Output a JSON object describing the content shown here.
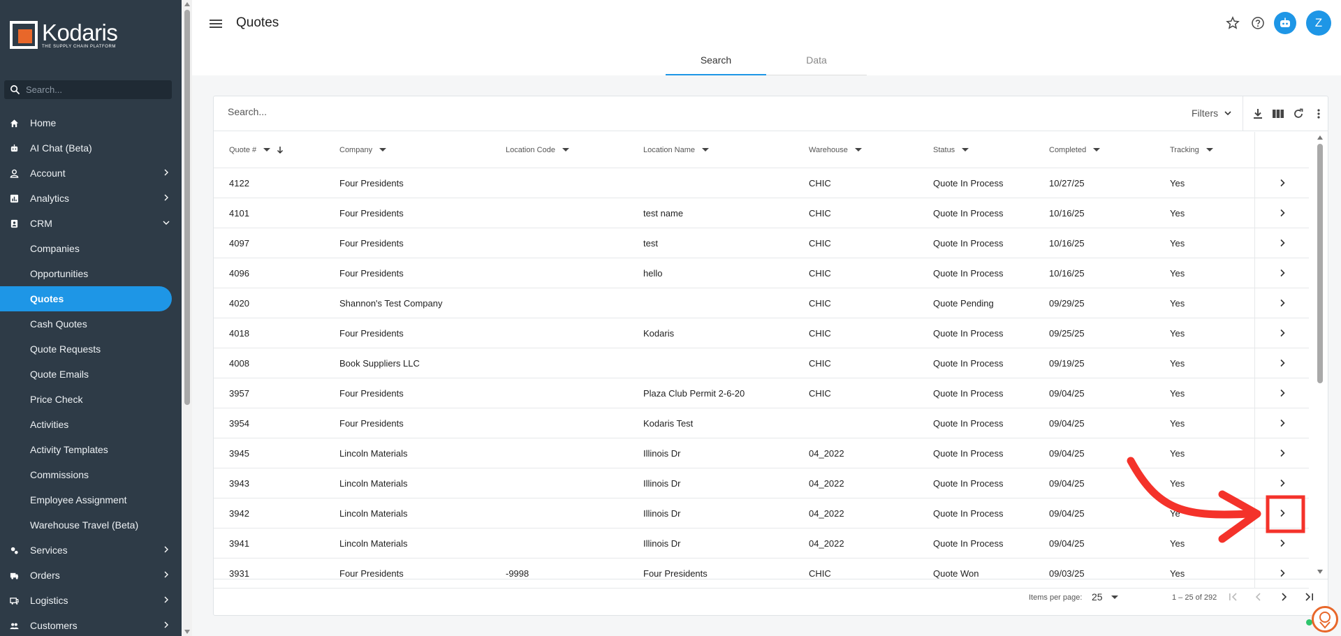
{
  "brand": {
    "name": "Kodaris",
    "tagline": "THE SUPPLY CHAIN PLATFORM"
  },
  "sidebar": {
    "search_placeholder": "Search...",
    "items": [
      {
        "label": "Home",
        "icon": "home-icon",
        "expandable": false
      },
      {
        "label": "AI Chat (Beta)",
        "icon": "robot-icon",
        "expandable": false
      },
      {
        "label": "Account",
        "icon": "person-icon",
        "expandable": true
      },
      {
        "label": "Analytics",
        "icon": "chart-icon",
        "expandable": true
      },
      {
        "label": "CRM",
        "icon": "contacts-icon",
        "expandable": true,
        "expanded": true
      }
    ],
    "crm_sub": [
      {
        "label": "Companies"
      },
      {
        "label": "Opportunities"
      },
      {
        "label": "Quotes",
        "active": true
      },
      {
        "label": "Cash Quotes"
      },
      {
        "label": "Quote Requests"
      },
      {
        "label": "Quote Emails"
      },
      {
        "label": "Price Check"
      },
      {
        "label": "Activities"
      },
      {
        "label": "Activity Templates"
      },
      {
        "label": "Commissions"
      },
      {
        "label": "Employee Assignment"
      },
      {
        "label": "Warehouse Travel (Beta)"
      }
    ],
    "items_after": [
      {
        "label": "Services",
        "icon": "services-icon",
        "expandable": true
      },
      {
        "label": "Orders",
        "icon": "truck-icon",
        "expandable": true
      },
      {
        "label": "Logistics",
        "icon": "logistics-icon",
        "expandable": true
      },
      {
        "label": "Customers",
        "icon": "people-icon",
        "expandable": true
      }
    ]
  },
  "header": {
    "title": "Quotes",
    "avatar_initial": "Z",
    "icons": [
      "star-icon",
      "help-icon",
      "robot-icon"
    ]
  },
  "tabs": [
    {
      "label": "Search",
      "active": true
    },
    {
      "label": "Data",
      "active": false
    }
  ],
  "table": {
    "search_placeholder": "Search...",
    "filters_label": "Filters",
    "columns": [
      "Quote #",
      "Company",
      "Location Code",
      "Location Name",
      "Warehouse",
      "Status",
      "Completed",
      "Tracking"
    ],
    "sort_column": "Quote #",
    "sort_direction": "desc",
    "rows": [
      [
        "4122",
        "Four Presidents",
        "",
        "",
        "CHIC",
        "Quote In Process",
        "10/27/25",
        "Yes"
      ],
      [
        "4101",
        "Four Presidents",
        "",
        "test name",
        "CHIC",
        "Quote In Process",
        "10/16/25",
        "Yes"
      ],
      [
        "4097",
        "Four Presidents",
        "",
        "test",
        "CHIC",
        "Quote In Process",
        "10/16/25",
        "Yes"
      ],
      [
        "4096",
        "Four Presidents",
        "",
        "hello",
        "CHIC",
        "Quote In Process",
        "10/16/25",
        "Yes"
      ],
      [
        "4020",
        "Shannon's Test Company",
        "",
        "",
        "CHIC",
        "Quote Pending",
        "09/29/25",
        "Yes"
      ],
      [
        "4018",
        "Four Presidents",
        "",
        "Kodaris",
        "CHIC",
        "Quote In Process",
        "09/25/25",
        "Yes"
      ],
      [
        "4008",
        "Book Suppliers LLC",
        "",
        "",
        "CHIC",
        "Quote In Process",
        "09/19/25",
        "Yes"
      ],
      [
        "3957",
        "Four Presidents",
        "",
        "Plaza Club Permit 2-6-20",
        "CHIC",
        "Quote In Process",
        "09/04/25",
        "Yes"
      ],
      [
        "3954",
        "Four Presidents",
        "",
        "Kodaris Test",
        "",
        "Quote In Process",
        "09/04/25",
        "Yes"
      ],
      [
        "3945",
        "Lincoln Materials",
        "",
        "Illinois Dr",
        "04_2022",
        "Quote In Process",
        "09/04/25",
        "Yes"
      ],
      [
        "3943",
        "Lincoln Materials",
        "",
        "Illinois Dr",
        "04_2022",
        "Quote In Process",
        "09/04/25",
        "Yes"
      ],
      [
        "3942",
        "Lincoln Materials",
        "",
        "Illinois Dr",
        "04_2022",
        "Quote In Process",
        "09/04/25",
        "Ye"
      ],
      [
        "3941",
        "Lincoln Materials",
        "",
        "Illinois Dr",
        "04_2022",
        "Quote In Process",
        "09/04/25",
        "Yes"
      ],
      [
        "3931",
        "Four Presidents",
        "-9998",
        "Four Presidents",
        "CHIC",
        "Quote Won",
        "09/03/25",
        "Yes"
      ]
    ],
    "highlighted_row": "3942",
    "items_per_page_label": "Items per page:",
    "items_per_page": "25",
    "range_label": "1 – 25 of 292"
  },
  "colors": {
    "accent": "#1e96e6",
    "sidebar_bg": "#2e3b47",
    "annotation": "#f4322a",
    "brand_orange": "#e8672a"
  }
}
